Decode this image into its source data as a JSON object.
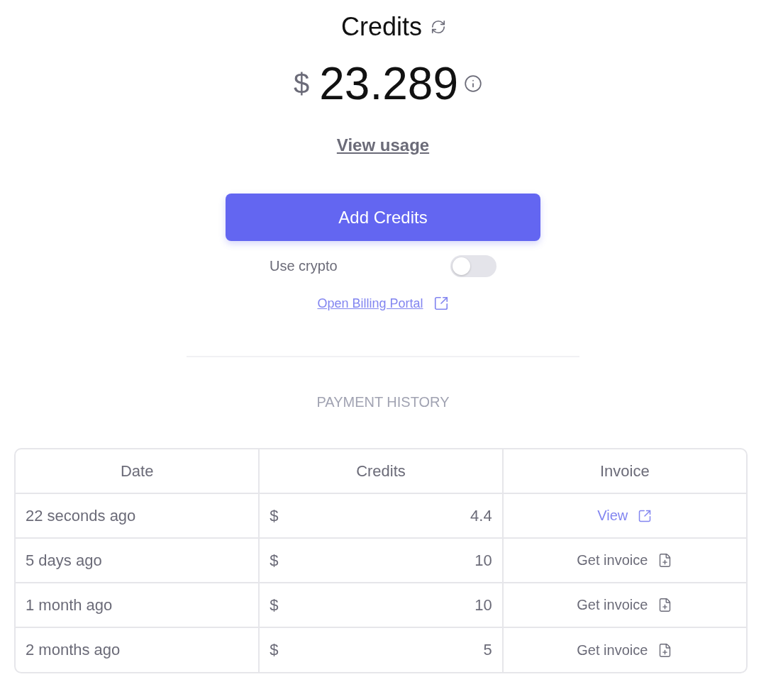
{
  "header": {
    "title": "Credits",
    "currency": "$",
    "balance": "23.289",
    "usage_link": "View usage"
  },
  "actions": {
    "add_button": "Add Credits",
    "crypto_toggle": {
      "label": "Use crypto",
      "on": false
    },
    "billing_link": "Open Billing Portal"
  },
  "payment_history": {
    "title": "PAYMENT HISTORY",
    "columns": [
      "Date",
      "Credits",
      "Invoice"
    ],
    "rows": [
      {
        "date": "22 seconds ago",
        "currency": "$",
        "credits": "4.4",
        "invoice": {
          "kind": "view",
          "label": "View"
        }
      },
      {
        "date": "5 days ago",
        "currency": "$",
        "credits": "10",
        "invoice": {
          "kind": "get",
          "label": "Get invoice"
        }
      },
      {
        "date": "1 month ago",
        "currency": "$",
        "credits": "10",
        "invoice": {
          "kind": "get",
          "label": "Get invoice"
        }
      },
      {
        "date": "2 months ago",
        "currency": "$",
        "credits": "5",
        "invoice": {
          "kind": "get",
          "label": "Get invoice"
        }
      }
    ]
  }
}
